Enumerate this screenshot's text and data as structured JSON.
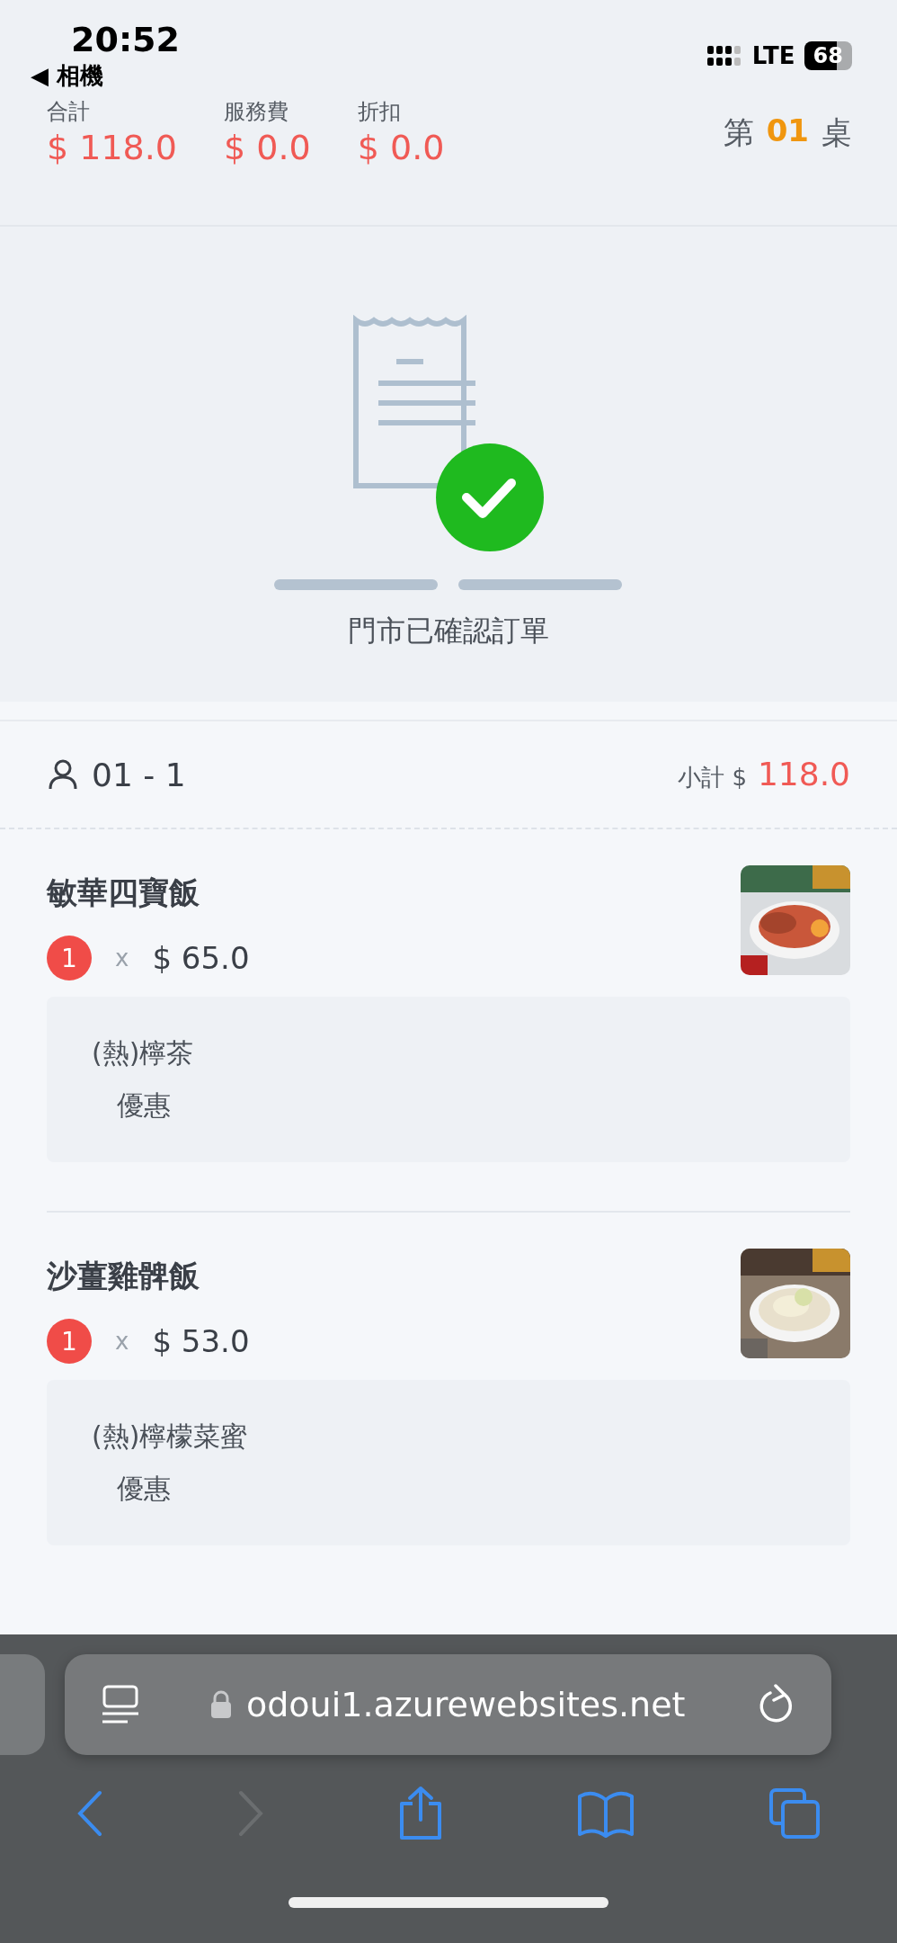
{
  "status_bar": {
    "time": "20:52",
    "back_app": "◀ 相機",
    "network": "LTE",
    "battery": "68"
  },
  "summary": {
    "totals": [
      {
        "label": "合計",
        "value": "$ 118.0"
      },
      {
        "label": "服務費",
        "value": "$ 0.0"
      },
      {
        "label": "折扣",
        "value": "$ 0.0"
      }
    ],
    "table": {
      "prefix": "第",
      "number": "01",
      "suffix": "桌"
    }
  },
  "confirmation": {
    "message": "門市已確認訂單"
  },
  "guest": {
    "name": "01 - 1",
    "subtotal_label": "小計 $",
    "subtotal": "118.0"
  },
  "items": [
    {
      "name": "敏華四寶飯",
      "quantity": "1",
      "times": "x",
      "price": "$ 65.0",
      "options": [
        {
          "name": "(熱)檸茶",
          "children": [
            {
              "name": "優惠"
            }
          ]
        }
      ]
    },
    {
      "name": "沙薑雞髀飯",
      "quantity": "1",
      "times": "x",
      "price": "$ 53.0",
      "options": [
        {
          "name": "(熱)檸檬菜蜜",
          "children": [
            {
              "name": "優惠"
            }
          ]
        }
      ]
    }
  ],
  "browser": {
    "url": "odoui1.azurewebsites.net",
    "back_disabled": false,
    "forward_disabled": true
  }
}
